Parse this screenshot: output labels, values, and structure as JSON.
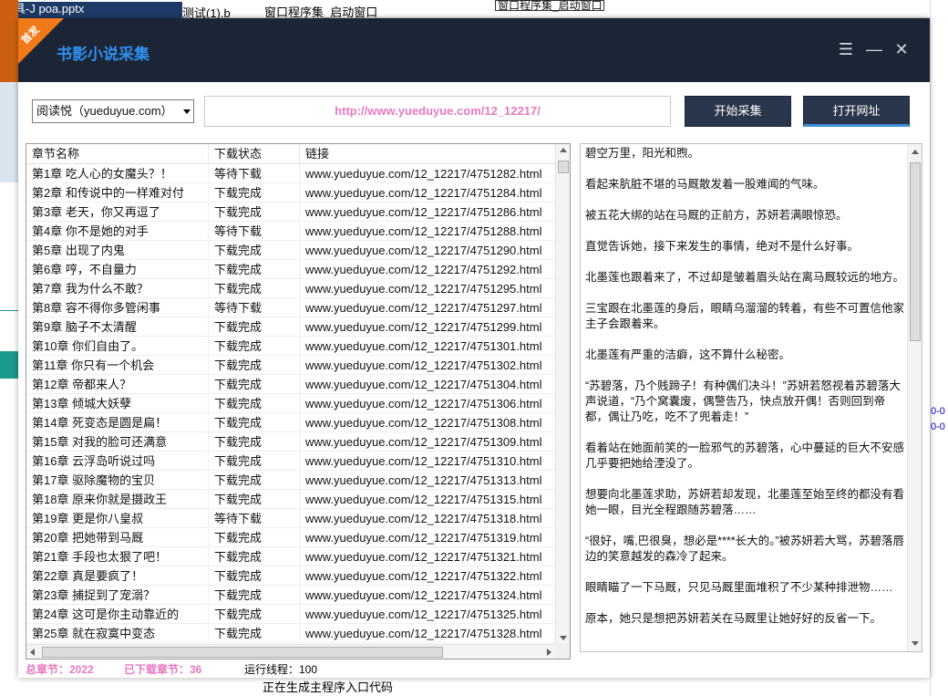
{
  "background": {
    "top_left_text": "工具-J      poa.pptx",
    "top_mid_text": "测试(1).b",
    "top_tree_text": "窗口程序集_启动窗口",
    "top_right_box": "窗口程序集_启动窗口",
    "bottom_text": "正在生成主程序入口代码"
  },
  "app": {
    "badge": "首发",
    "title": "书影小说采集",
    "menu_icon": "menu-icon",
    "minimize_icon": "minimize-icon",
    "close_icon": "close-icon"
  },
  "toolbar": {
    "source_selected": "阅读悦（yueduyue.com）",
    "url": "http://www.yueduyue.com/12_12217/",
    "start_label": "开始采集",
    "open_label": "打开网址"
  },
  "table": {
    "headers": [
      "章节名称",
      "下载状态",
      "链接"
    ],
    "rows": [
      [
        "第1章 吃人心的女魔头？！",
        "等待下载",
        "www.yueduyue.com/12_12217/4751282.html"
      ],
      [
        "第2章 和传说中的一样难对付",
        "下载完成",
        "www.yueduyue.com/12_12217/4751284.html"
      ],
      [
        "第3章 老天，你又再逗了",
        "下载完成",
        "www.yueduyue.com/12_12217/4751286.html"
      ],
      [
        "第4章 你不是她的对手",
        "等待下载",
        "www.yueduyue.com/12_12217/4751288.html"
      ],
      [
        "第5章 出现了内鬼",
        "下载完成",
        "www.yueduyue.com/12_12217/4751290.html"
      ],
      [
        "第6章 哼，不自量力",
        "下载完成",
        "www.yueduyue.com/12_12217/4751292.html"
      ],
      [
        "第7章 我为什么不敢？",
        "下载完成",
        "www.yueduyue.com/12_12217/4751295.html"
      ],
      [
        "第8章 容不得你多管闲事",
        "等待下载",
        "www.yueduyue.com/12_12217/4751297.html"
      ],
      [
        "第9章 脑子不太清醒",
        "下载完成",
        "www.yueduyue.com/12_12217/4751299.html"
      ],
      [
        "第10章 你们自由了。",
        "下载完成",
        "www.yueduyue.com/12_12217/4751301.html"
      ],
      [
        "第11章 你只有一个机会",
        "下载完成",
        "www.yueduyue.com/12_12217/4751302.html"
      ],
      [
        "第12章 帝都来人？",
        "下载完成",
        "www.yueduyue.com/12_12217/4751304.html"
      ],
      [
        "第13章 倾城大妖孽",
        "下载完成",
        "www.yueduyue.com/12_12217/4751306.html"
      ],
      [
        "第14章 死变态是圆是扁！",
        "下载完成",
        "www.yueduyue.com/12_12217/4751308.html"
      ],
      [
        "第15章 对我的脸可还满意",
        "下载完成",
        "www.yueduyue.com/12_12217/4751309.html"
      ],
      [
        "第16章 云浮岛听说过吗",
        "下载完成",
        "www.yueduyue.com/12_12217/4751310.html"
      ],
      [
        "第17章 驱除魔物的宝贝",
        "下载完成",
        "www.yueduyue.com/12_12217/4751313.html"
      ],
      [
        "第18章 原来你就是摄政王",
        "下载完成",
        "www.yueduyue.com/12_12217/4751315.html"
      ],
      [
        "第19章 更是你八皇叔",
        "等待下载",
        "www.yueduyue.com/12_12217/4751318.html"
      ],
      [
        "第20章 把她带到马厩",
        "下载完成",
        "www.yueduyue.com/12_12217/4751319.html"
      ],
      [
        "第21章 手段也太狠了吧！",
        "下载完成",
        "www.yueduyue.com/12_12217/4751321.html"
      ],
      [
        "第22章 真是要疯了！",
        "下载完成",
        "www.yueduyue.com/12_12217/4751322.html"
      ],
      [
        "第23章 捕捉到了宠溺？",
        "下载完成",
        "www.yueduyue.com/12_12217/4751324.html"
      ],
      [
        "第24章 这可是你主动靠近的",
        "下载完成",
        "www.yueduyue.com/12_12217/4751325.html"
      ],
      [
        "第25章 就在寂寞中变态",
        "下载完成",
        "www.yueduyue.com/12_12217/4751328.html"
      ]
    ]
  },
  "preview": {
    "paragraphs": [
      "碧空万里，阳光和煦。",
      "看起来肮脏不堪的马厩散发着一股难闻的气味。",
      "被五花大绑的站在马厩的正前方，苏妍若满眼惊恐。",
      "直觉告诉她，接下来发生的事情，绝对不是什么好事。",
      "北墨莲也跟着来了，不过却是皱着眉头站在离马厩较远的地方。",
      "三宝跟在北墨莲的身后，眼睛乌溜溜的转着，有些不可置信他家主子会跟着来。",
      "北墨莲有严重的洁癖，这不算什么秘密。",
      "“苏碧落，乃个贱蹄子！有种偶们决斗！”苏妍若怒视着苏碧落大声说道，“乃个窝囊废，偶警告乃，快点放开偶！否则回到帝都，偶让乃吃，吃不了兜着走！”",
      "看着站在她面前笑的一脸邪气的苏碧落，心中蔓延的巨大不安感几乎要把她给湮没了。",
      "想要向北墨莲求助，苏妍若却发现，北墨莲至始至终的都没有看她一眼，目光全程跟随苏碧落……",
      "“很好，嘴,巴很臭，想必是****长大的。”被苏妍若大骂，苏碧落唇边的笑意越发的森冷了起来。",
      "眼睛瞄了一下马厩，只见马厩里面堆积了不少某种排泄物……",
      "原本，她只是想把苏妍若关在马厩里让她好好的反省一下。"
    ]
  },
  "status": {
    "total_label": "总章节：2022",
    "done_label": "已下载章节：36",
    "threads_label": "运行线程：100"
  },
  "colors": {
    "titlebar": "#1c2535",
    "title_text": "#2f8ff0",
    "badge": "#f07a1a",
    "url_text": "#e87ac0",
    "button": "#2a364b",
    "status_pink": "#e87ac0"
  }
}
